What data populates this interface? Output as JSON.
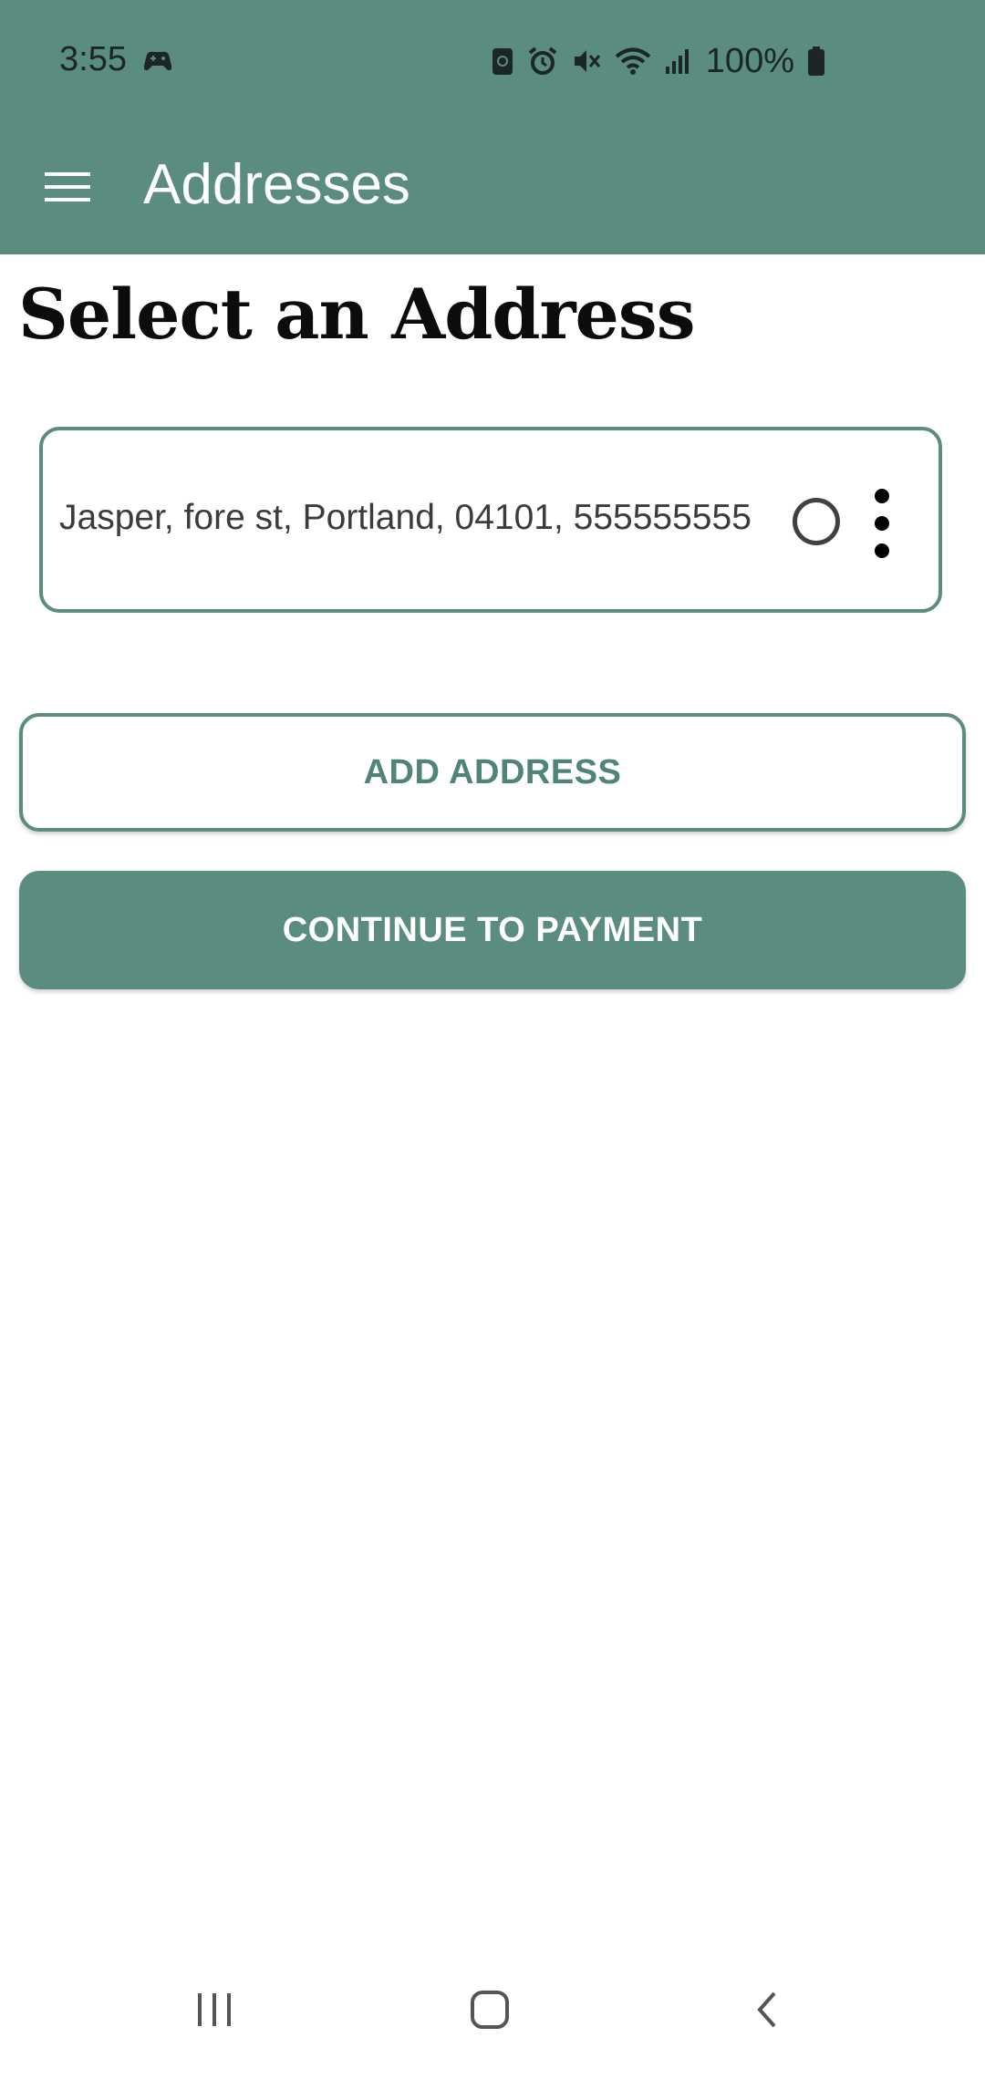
{
  "status_bar": {
    "time": "3:55",
    "battery_percent": "100%",
    "icons": [
      "game-controller-icon",
      "screenshot-lock-icon",
      "alarm-icon",
      "vibrate-off-icon",
      "wifi-icon",
      "signal-icon",
      "battery-icon"
    ]
  },
  "app_bar": {
    "title": "Addresses",
    "menu_icon": "hamburger-menu-icon",
    "background_color": "#5a8c80"
  },
  "main": {
    "heading": "Select an Address",
    "addresses": [
      {
        "text": "Jasper, fore st, Portland, 04101, 555555555",
        "selected": false
      }
    ],
    "add_address_label": "ADD ADDRESS",
    "continue_label": "CONTINUE TO PAYMENT",
    "accent_color": "#5a8c80"
  },
  "nav_bar": {
    "buttons": [
      "recents-icon",
      "home-icon",
      "back-icon"
    ]
  }
}
